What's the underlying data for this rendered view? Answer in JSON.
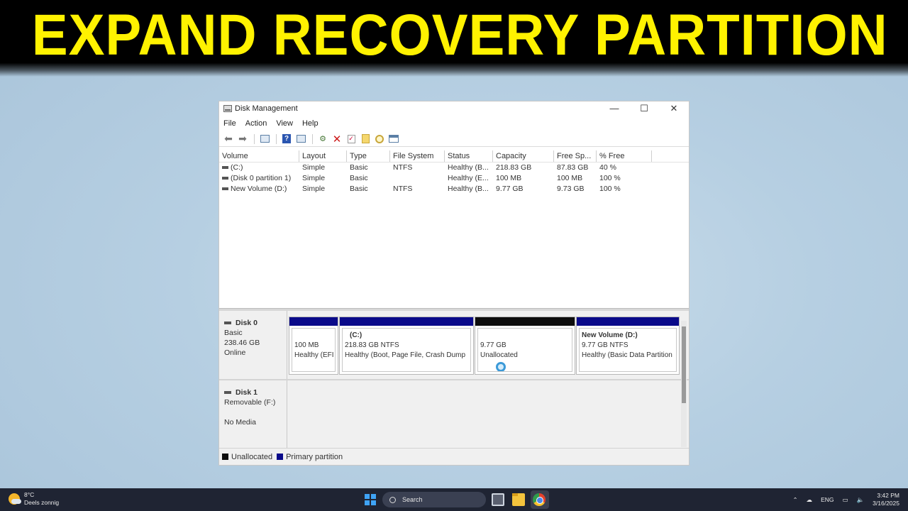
{
  "banner": {
    "title": "EXPAND RECOVERY PARTITION"
  },
  "window": {
    "title": "Disk Management",
    "controls": {
      "minimize": "—",
      "maximize": "☐",
      "close": "✕"
    }
  },
  "menu": [
    "File",
    "Action",
    "View",
    "Help"
  ],
  "volume_table": {
    "columns": [
      "Volume",
      "Layout",
      "Type",
      "File System",
      "Status",
      "Capacity",
      "Free Sp...",
      "% Free"
    ],
    "rows": [
      [
        "(C:)",
        "Simple",
        "Basic",
        "NTFS",
        "Healthy (B...",
        "218.83 GB",
        "87.83 GB",
        "40 %"
      ],
      [
        "(Disk 0 partition 1)",
        "Simple",
        "Basic",
        "",
        "Healthy (E...",
        "100 MB",
        "100 MB",
        "100 %"
      ],
      [
        "New Volume (D:)",
        "Simple",
        "Basic",
        "NTFS",
        "Healthy (B...",
        "9.77 GB",
        "9.73 GB",
        "100 %"
      ]
    ]
  },
  "disks": [
    {
      "name": "Disk 0",
      "type": "Basic",
      "size": "238.46 GB",
      "status": "Online",
      "partitions": [
        {
          "name": "",
          "line1": "100 MB",
          "line2": "Healthy (EFI",
          "kind": "primary"
        },
        {
          "name": "(C:)",
          "line1": "218.83 GB NTFS",
          "line2": "Healthy (Boot, Page File, Crash Dump",
          "kind": "primary"
        },
        {
          "name": "",
          "line1": "9.77 GB",
          "line2": "Unallocated",
          "kind": "unallocated"
        },
        {
          "name": "New Volume  (D:)",
          "line1": "9.77 GB NTFS",
          "line2": "Healthy (Basic Data Partition",
          "kind": "primary"
        }
      ]
    },
    {
      "name": "Disk 1",
      "type": "Removable (F:)",
      "status": "No Media"
    }
  ],
  "legend": [
    {
      "label": "Unallocated",
      "color": "#0d0d0d"
    },
    {
      "label": "Primary partition",
      "color": "#0a0a8a"
    }
  ],
  "taskbar": {
    "weather_temp": "8°C",
    "weather_desc": "Deels zonnig",
    "search_placeholder": "Search",
    "language": "ENG",
    "time": "3:42 PM",
    "date": "3/16/2025"
  }
}
